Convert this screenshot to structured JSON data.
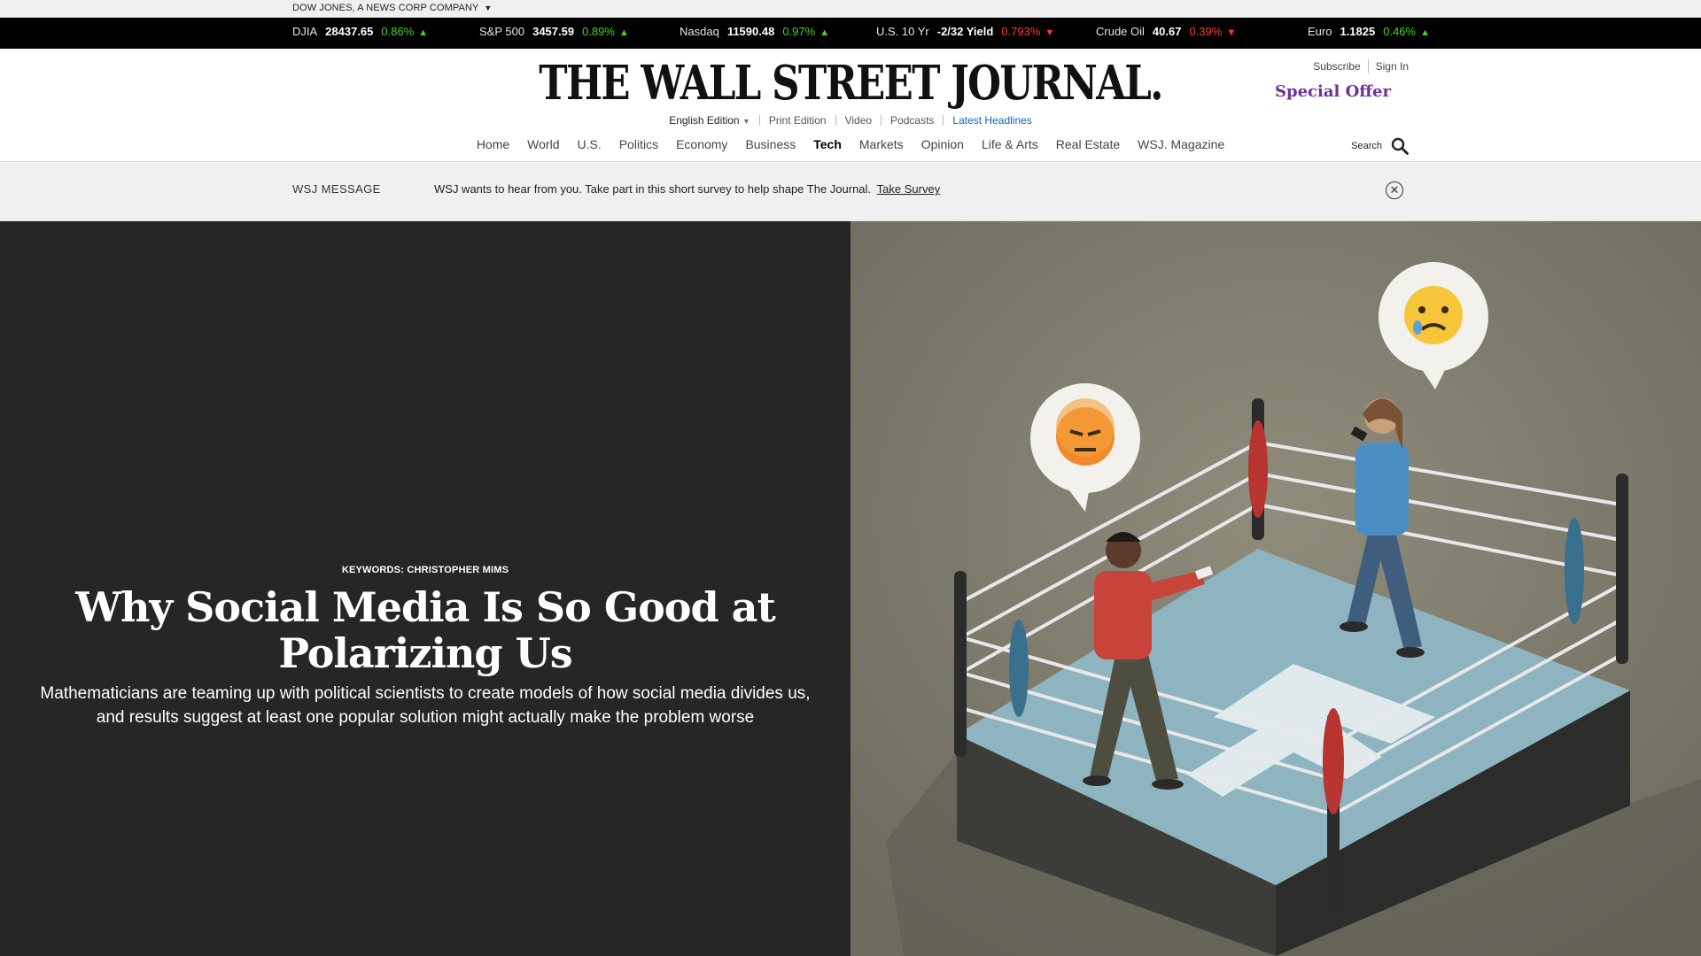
{
  "corp_bar": {
    "label": "DOW JONES, A NEWS CORP COMPANY"
  },
  "ticker": [
    {
      "name": "DJIA",
      "value": "28437.65",
      "change": "0.86%",
      "direction": "up"
    },
    {
      "name": "S&P 500",
      "value": "3457.59",
      "change": "0.89%",
      "direction": "up"
    },
    {
      "name": "Nasdaq",
      "value": "11590.48",
      "change": "0.97%",
      "direction": "up"
    },
    {
      "name": "U.S. 10 Yr",
      "value": "-2/32 Yield",
      "change": "0.793%",
      "direction": "down"
    },
    {
      "name": "Crude Oil",
      "value": "40.67",
      "change": "0.39%",
      "direction": "down"
    },
    {
      "name": "Euro",
      "value": "1.1825",
      "change": "0.46%",
      "direction": "up"
    }
  ],
  "masthead": {
    "logo": "THE WALL STREET JOURNAL.",
    "edition": "English Edition",
    "links": [
      "Print Edition",
      "Video",
      "Podcasts",
      "Latest Headlines"
    ],
    "subscribe": "Subscribe",
    "sign_in": "Sign In",
    "special_offer": "Special Offer"
  },
  "nav": {
    "items": [
      "Home",
      "World",
      "U.S.",
      "Politics",
      "Economy",
      "Business",
      "Tech",
      "Markets",
      "Opinion",
      "Life & Arts",
      "Real Estate",
      "WSJ. Magazine"
    ],
    "active": "Tech",
    "search_label": "Search"
  },
  "message": {
    "label": "WSJ MESSAGE",
    "text": "WSJ wants to hear from you. Take part in this short survey to help shape The Journal.",
    "link": "Take Survey"
  },
  "article": {
    "keywords": "KEYWORDS: CHRISTOPHER MIMS",
    "headline": "Why Social Media Is So Good at Polarizing Us",
    "dek": "Mathematicians are teaming up with political scientists to create models of how social media divides us, and results suggest at least one popular solution might actually make the problem worse"
  },
  "colors": {
    "ticker_up": "#4cd31b",
    "ticker_down": "#ff3b30",
    "special_offer": "#6d2f9c",
    "latest_headlines": "#0b66c2",
    "hero_left_bg": "#262626",
    "hero_right_bg": "#7f7d6d"
  }
}
